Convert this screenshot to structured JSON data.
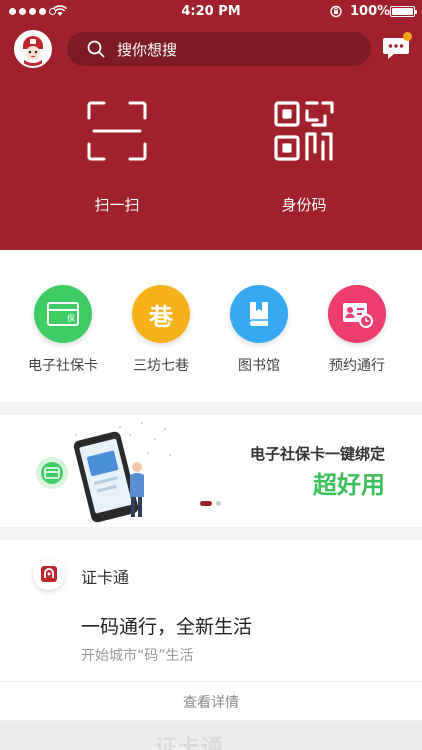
{
  "status": {
    "time": "4:20 PM",
    "battery": "100%"
  },
  "search": {
    "placeholder": "搜你想搜"
  },
  "actions": [
    {
      "label": "扫一扫",
      "icon": "scan-icon"
    },
    {
      "label": "身份码",
      "icon": "qr-code-icon"
    }
  ],
  "services": [
    {
      "label": "电子社保卡",
      "icon": "social-security-card-icon",
      "color": "#3fcd63",
      "badge": "保"
    },
    {
      "label": "三坊七巷",
      "icon": "lane-icon",
      "color": "#f6b21b",
      "badge": "巷"
    },
    {
      "label": "图书馆",
      "icon": "library-book-icon",
      "color": "#36a9f2"
    },
    {
      "label": "预约通行",
      "icon": "reservation-pass-icon",
      "color": "#ec3d6e"
    }
  ],
  "banner": {
    "line1": "电子社保卡一键绑定",
    "line2": "超好用"
  },
  "card": {
    "name": "证卡通",
    "slogan": "一码通行，全新生活",
    "subtitle": "开始城市“码”生活",
    "more": "查看详情"
  },
  "footer": {
    "watermark": "证卡通"
  },
  "colors": {
    "brand": "#a0212b",
    "accent_green": "#3dbf5a",
    "badge_orange": "#f4a21f"
  }
}
